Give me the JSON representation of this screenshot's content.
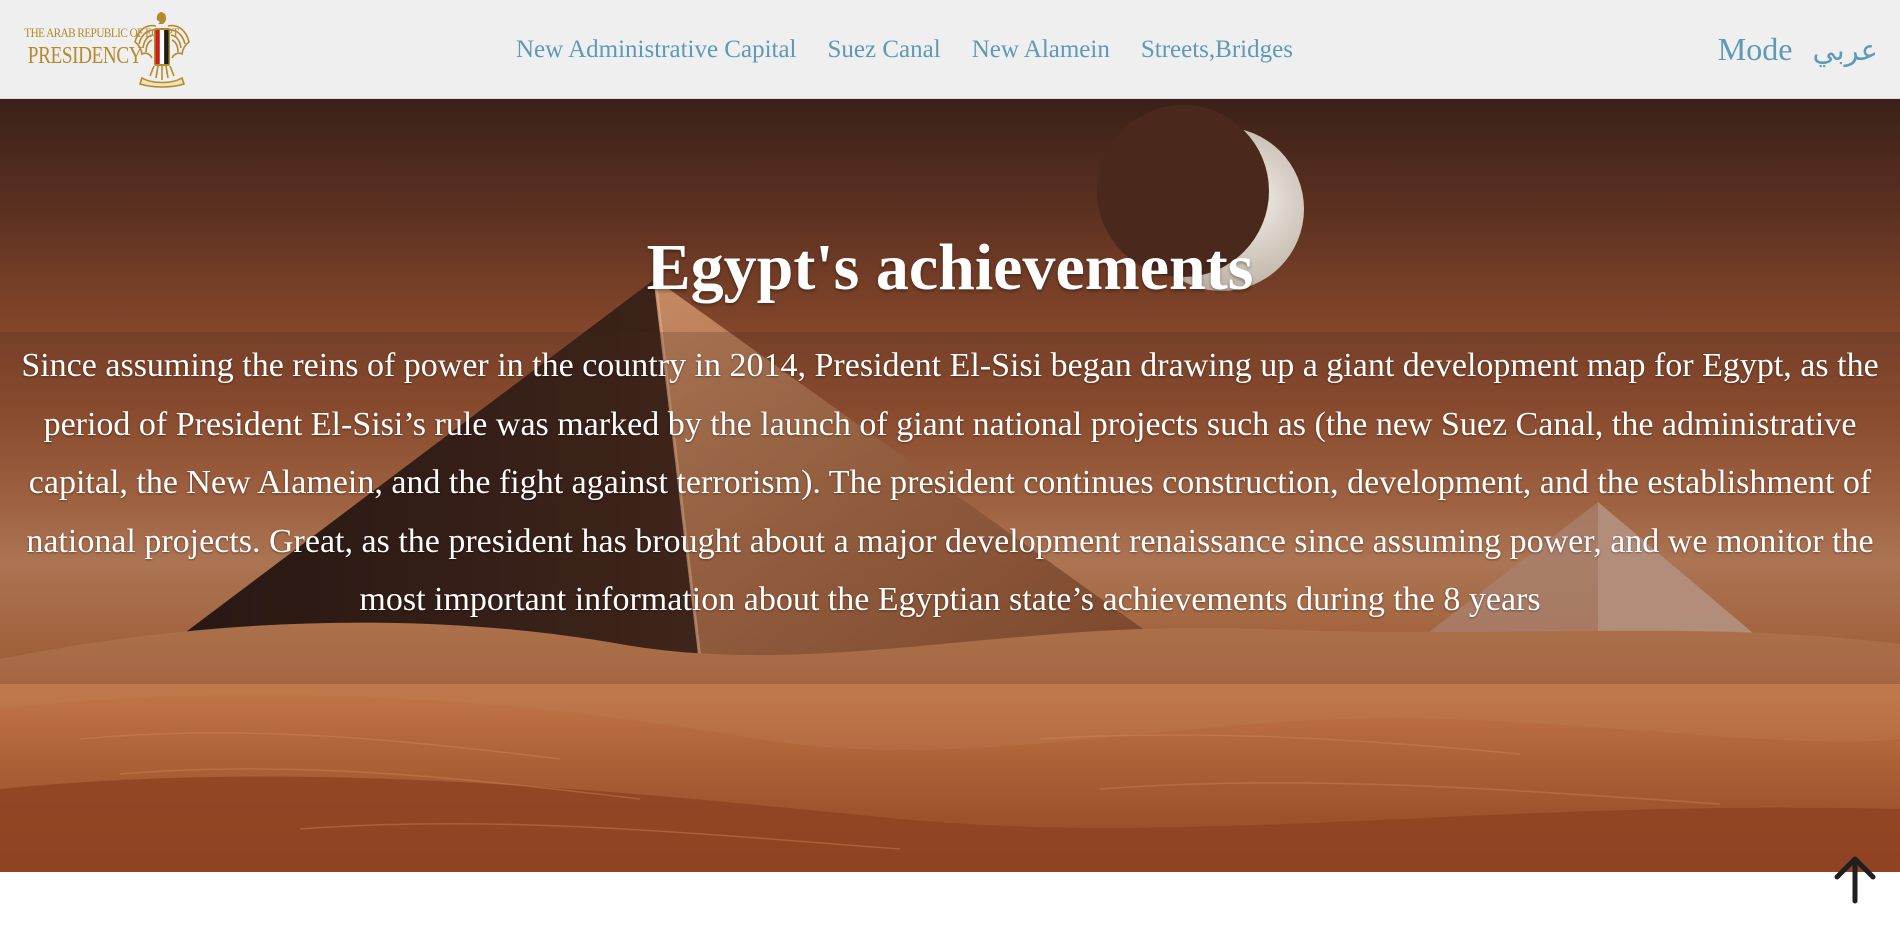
{
  "navbar": {
    "logo": {
      "line1": "THE ARAB REPUBLIC OF EGYPT",
      "line2": "PRESIDENCY",
      "emblem_icon": "eagle-of-saladin-emblem"
    },
    "links": [
      {
        "label": "New Administrative Capital"
      },
      {
        "label": "Suez Canal"
      },
      {
        "label": "New Alamein"
      },
      {
        "label": "Streets,Bridges"
      }
    ],
    "mode_label": "Mode",
    "language_label": "عربي"
  },
  "hero": {
    "title": "Egypt's achievements",
    "description": "Since assuming the reins of power in the country in 2014, President El-Sisi began drawing up a giant development map for Egypt, as the period of President El-Sisi’s rule was marked by the launch of giant national projects such as (the new Suez Canal, the administrative capital, the New Alamein, and the fight against terrorism). The president continues construction, development, and the establishment of national projects. Great, as the president has brought about a major development renaissance since assuming power, and we monitor the most important information about the Egyptian state’s achievements during the 8 years"
  },
  "back_to_top": {
    "icon": "arrow-up-icon"
  },
  "colors": {
    "navbar_bg": "#efefef",
    "nav_link": "#5d9ab8",
    "logo_gold": "#b48a2c",
    "hero_text": "#ffffff"
  }
}
